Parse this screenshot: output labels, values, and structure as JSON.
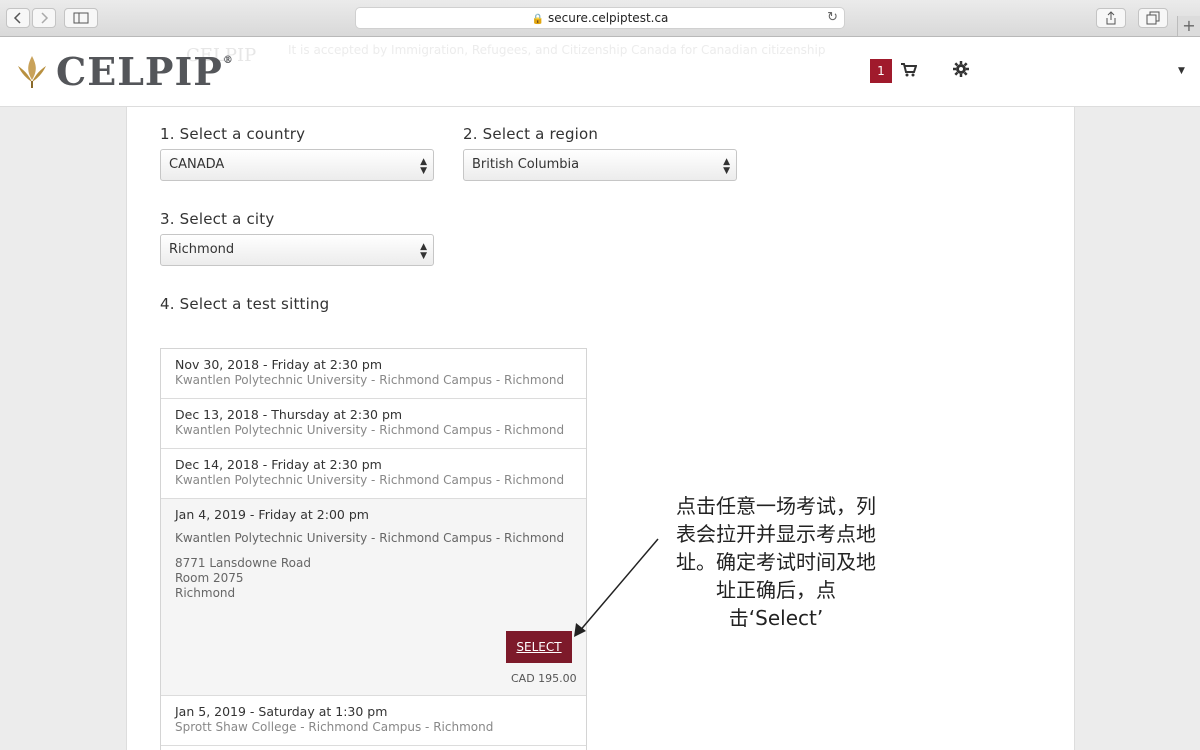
{
  "browser": {
    "url": "secure.celpiptest.ca"
  },
  "header": {
    "logo": "CELPIP",
    "registered": "®",
    "ghost_logo": "CELPIP",
    "ghost_tagline": "It is accepted by Immigration, Refugees, and Citizenship Canada for Canadian citizenship",
    "cart_count": "1"
  },
  "form": {
    "country_label": "1. Select a country",
    "country_value": "CANADA",
    "region_label": "2. Select a region",
    "region_value": "British Columbia",
    "city_label": "3. Select a city",
    "city_value": "Richmond",
    "sitting_label": "4. Select a test sitting"
  },
  "sittings": [
    {
      "date": "Nov 30, 2018 - Friday at 2:30 pm",
      "venue": "Kwantlen Polytechnic University - Richmond Campus - Richmond"
    },
    {
      "date": "Dec 13, 2018 - Thursday at 2:30 pm",
      "venue": "Kwantlen Polytechnic University - Richmond Campus - Richmond"
    },
    {
      "date": "Dec 14, 2018 - Friday at 2:30 pm",
      "venue": "Kwantlen Polytechnic University - Richmond Campus - Richmond"
    },
    {
      "date": "Jan 4, 2019 - Friday at 2:00 pm",
      "venue": "Kwantlen Polytechnic University - Richmond Campus - Richmond",
      "address1": "8771 Lansdowne Road",
      "address2": "Room 2075",
      "address3": "Richmond",
      "select_label": "SELECT",
      "price": "CAD 195.00"
    },
    {
      "date": "Jan 5, 2019 - Saturday at 1:30 pm",
      "venue": "Sprott Shaw College - Richmond Campus - Richmond"
    }
  ],
  "annotation": {
    "line1": "点击任意一场考试，列",
    "line2": "表会拉开并显示考点地",
    "line3": "址。确定考试时间及地",
    "line4": "址正确后，点",
    "line5": "击‘Select’"
  },
  "colors": {
    "brand_red": "#a01a2c",
    "select_button": "#7d1a2a"
  }
}
